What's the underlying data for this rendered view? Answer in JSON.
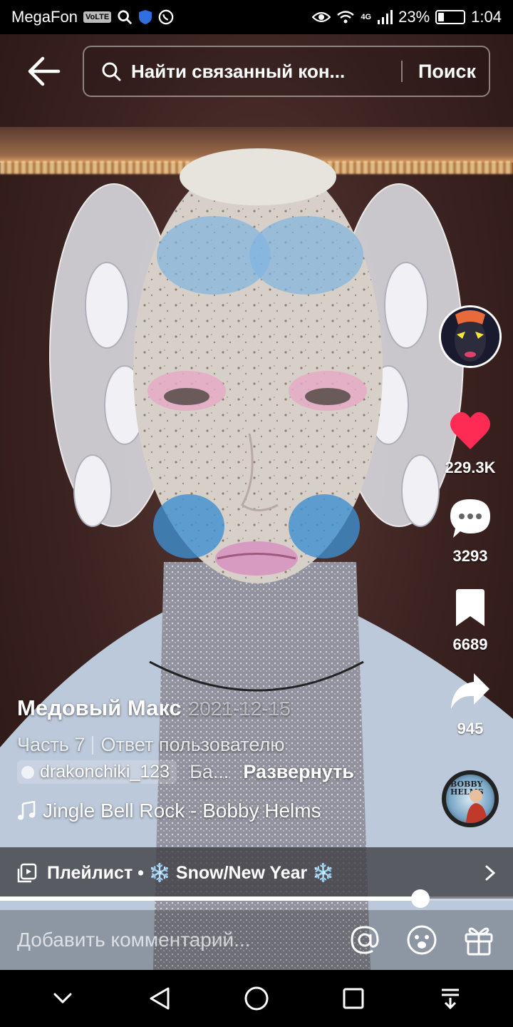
{
  "status_bar": {
    "carrier": "MegaFon",
    "volte_badge": "VoLTE",
    "network": "4G",
    "battery": "23%",
    "battery_level": 0.23,
    "time": "1:04"
  },
  "search": {
    "query": "Найти связанный кон...",
    "button": "Поиск"
  },
  "actions": {
    "likes": "229.3K",
    "comments": "3293",
    "saves": "6689",
    "shares": "945"
  },
  "caption": {
    "author": "Медовый Макс",
    "date": "2021-12-15",
    "part": "Часть 7",
    "reply": "Ответ пользователю",
    "mention": "drakonchiki_123",
    "mention_tail": "Ба...",
    "expand": "Развернуть",
    "music": "Jingle Bell Rock - Bobby Helms"
  },
  "music_disc_text": "BOBBY HELMS",
  "playlist": {
    "text": "Плейлист • ❄️ Snow/New Year ❄️"
  },
  "progress": 0.82,
  "comment": {
    "placeholder": "Добавить комментарий..."
  },
  "icons": {
    "back": "arrow-left-icon",
    "search": "search-icon",
    "like": "heart-icon",
    "comment": "comment-bubble-icon",
    "save": "bookmark-icon",
    "share": "share-arrow-icon",
    "music": "music-note-icon",
    "playlist": "playlist-icon",
    "mention": "at-icon",
    "emoji": "emoji-icon",
    "gift": "gift-icon"
  },
  "colors": {
    "like": "#fe2c55",
    "overlay": "#3c3c40"
  }
}
